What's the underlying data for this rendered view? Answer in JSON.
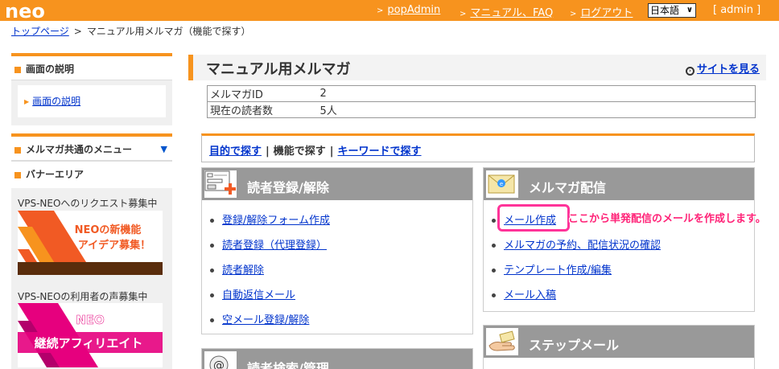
{
  "header": {
    "logo_text": "neo",
    "nav": [
      {
        "label": "popAdmin"
      },
      {
        "label": "マニュアル、FAQ"
      },
      {
        "label": "ログアウト"
      }
    ],
    "language": "日本語",
    "user": "[ admin ]",
    "accent_color": "#f7931e"
  },
  "breadcrumb": {
    "home": "トップページ",
    "separator": ">",
    "current": "マニュアル用メルマガ（機能で探す）"
  },
  "sidebar": {
    "description_heading": "画面の説明",
    "description_link": "画面の説明",
    "common_menu_heading": "メルマガ共通のメニュー",
    "banner_heading": "バナーエリア",
    "banners": [
      {
        "caption": "VPS-NEOへのリクエスト募集中",
        "line1": "NEOの新機能",
        "line2": "アイデア募集！"
      },
      {
        "caption": "VPS-NEOの利用者の声募集中",
        "line1": "NEO",
        "line2": "継続アフィリエイト"
      }
    ]
  },
  "main": {
    "title": "マニュアル用メルマガ",
    "site_link": "サイトを見る",
    "info": [
      {
        "key": "メルマガID",
        "value": "2"
      },
      {
        "key": "現在の読者数",
        "value": "5人"
      }
    ],
    "tabs": {
      "purpose": "目的で探す",
      "function": "機能で探す",
      "keyword": "キーワードで探す",
      "separator": "|"
    },
    "panels": {
      "reader": {
        "title": "読者登録/解除",
        "items": [
          "登録/解除フォーム作成",
          "読者登録（代理登録）",
          "読者解除",
          "自動返信メール",
          "空メール登録/解除"
        ]
      },
      "magazine": {
        "title": "メルマガ配信",
        "items": [
          "メール作成",
          "メルマガの予約、配信状況の確認",
          "テンプレート作成/編集",
          "メール入稿"
        ]
      },
      "search": {
        "title": "読者検索/管理"
      },
      "step": {
        "title": "ステップメール"
      }
    },
    "callout": "ここから単発配信のメールを作成します。"
  }
}
